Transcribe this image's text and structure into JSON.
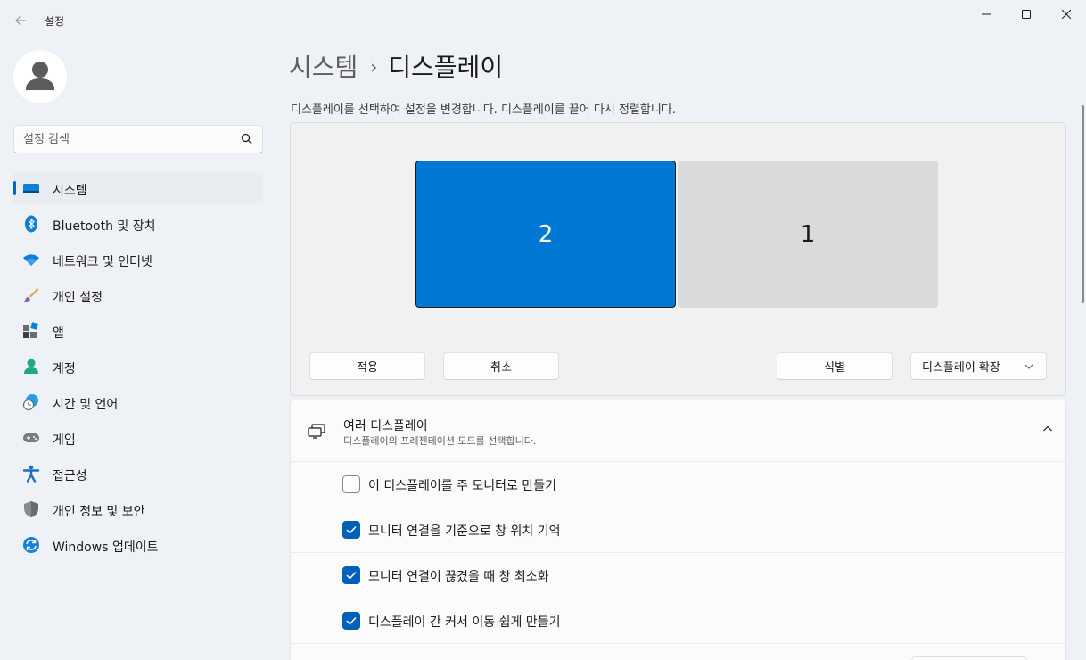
{
  "window": {
    "app_title": "설정",
    "back_icon": "back-arrow-icon",
    "controls": [
      "minimize-icon",
      "maximize-icon",
      "close-icon"
    ]
  },
  "sidebar": {
    "search_placeholder": "설정 검색",
    "items": [
      {
        "label": "시스템",
        "icon": "system-monitor-icon",
        "active": true
      },
      {
        "label": "Bluetooth 및 장치",
        "icon": "bluetooth-icon",
        "active": false
      },
      {
        "label": "네트워크 및 인터넷",
        "icon": "wifi-icon",
        "active": false
      },
      {
        "label": "개인 설정",
        "icon": "paintbrush-icon",
        "active": false
      },
      {
        "label": "앱",
        "icon": "apps-icon",
        "active": false
      },
      {
        "label": "계정",
        "icon": "account-icon",
        "active": false
      },
      {
        "label": "시간 및 언어",
        "icon": "time-language-icon",
        "active": false
      },
      {
        "label": "게임",
        "icon": "gamepad-icon",
        "active": false
      },
      {
        "label": "접근성",
        "icon": "accessibility-icon",
        "active": false
      },
      {
        "label": "개인 정보 및 보안",
        "icon": "shield-icon",
        "active": false
      },
      {
        "label": "Windows 업데이트",
        "icon": "windows-update-icon",
        "active": false
      }
    ]
  },
  "header": {
    "parent": "시스템",
    "separator": "›",
    "current": "디스플레이"
  },
  "arrangement": {
    "description": "디스플레이를 선택하여 설정을 변경합니다. 디스플레이를 끌어 다시 정렬합니다.",
    "monitors": [
      {
        "number": "2",
        "selected": true
      },
      {
        "number": "1",
        "selected": false
      }
    ],
    "apply_label": "적용",
    "cancel_label": "취소",
    "identify_label": "식별",
    "mode_label": "디스플레이 확장"
  },
  "multiple_displays": {
    "title": "여러 디스플레이",
    "subtitle": "디스플레이의 프레젠테이션 모드를 선택합니다.",
    "options": [
      {
        "label": "이 디스플레이를 주 모니터로 만들기",
        "checked": false
      },
      {
        "label": "모니터 연결을 기준으로 창 위치 기억",
        "checked": true
      },
      {
        "label": "모니터 연결이 끊겼을 때 창 최소화",
        "checked": true
      },
      {
        "label": "디스플레이 간 커서 이동 쉽게 만들기",
        "checked": true
      }
    ]
  },
  "colors": {
    "accent": "#0067c0",
    "selected_monitor": "#0078d4",
    "checkbox_checked": "#005fb8"
  }
}
